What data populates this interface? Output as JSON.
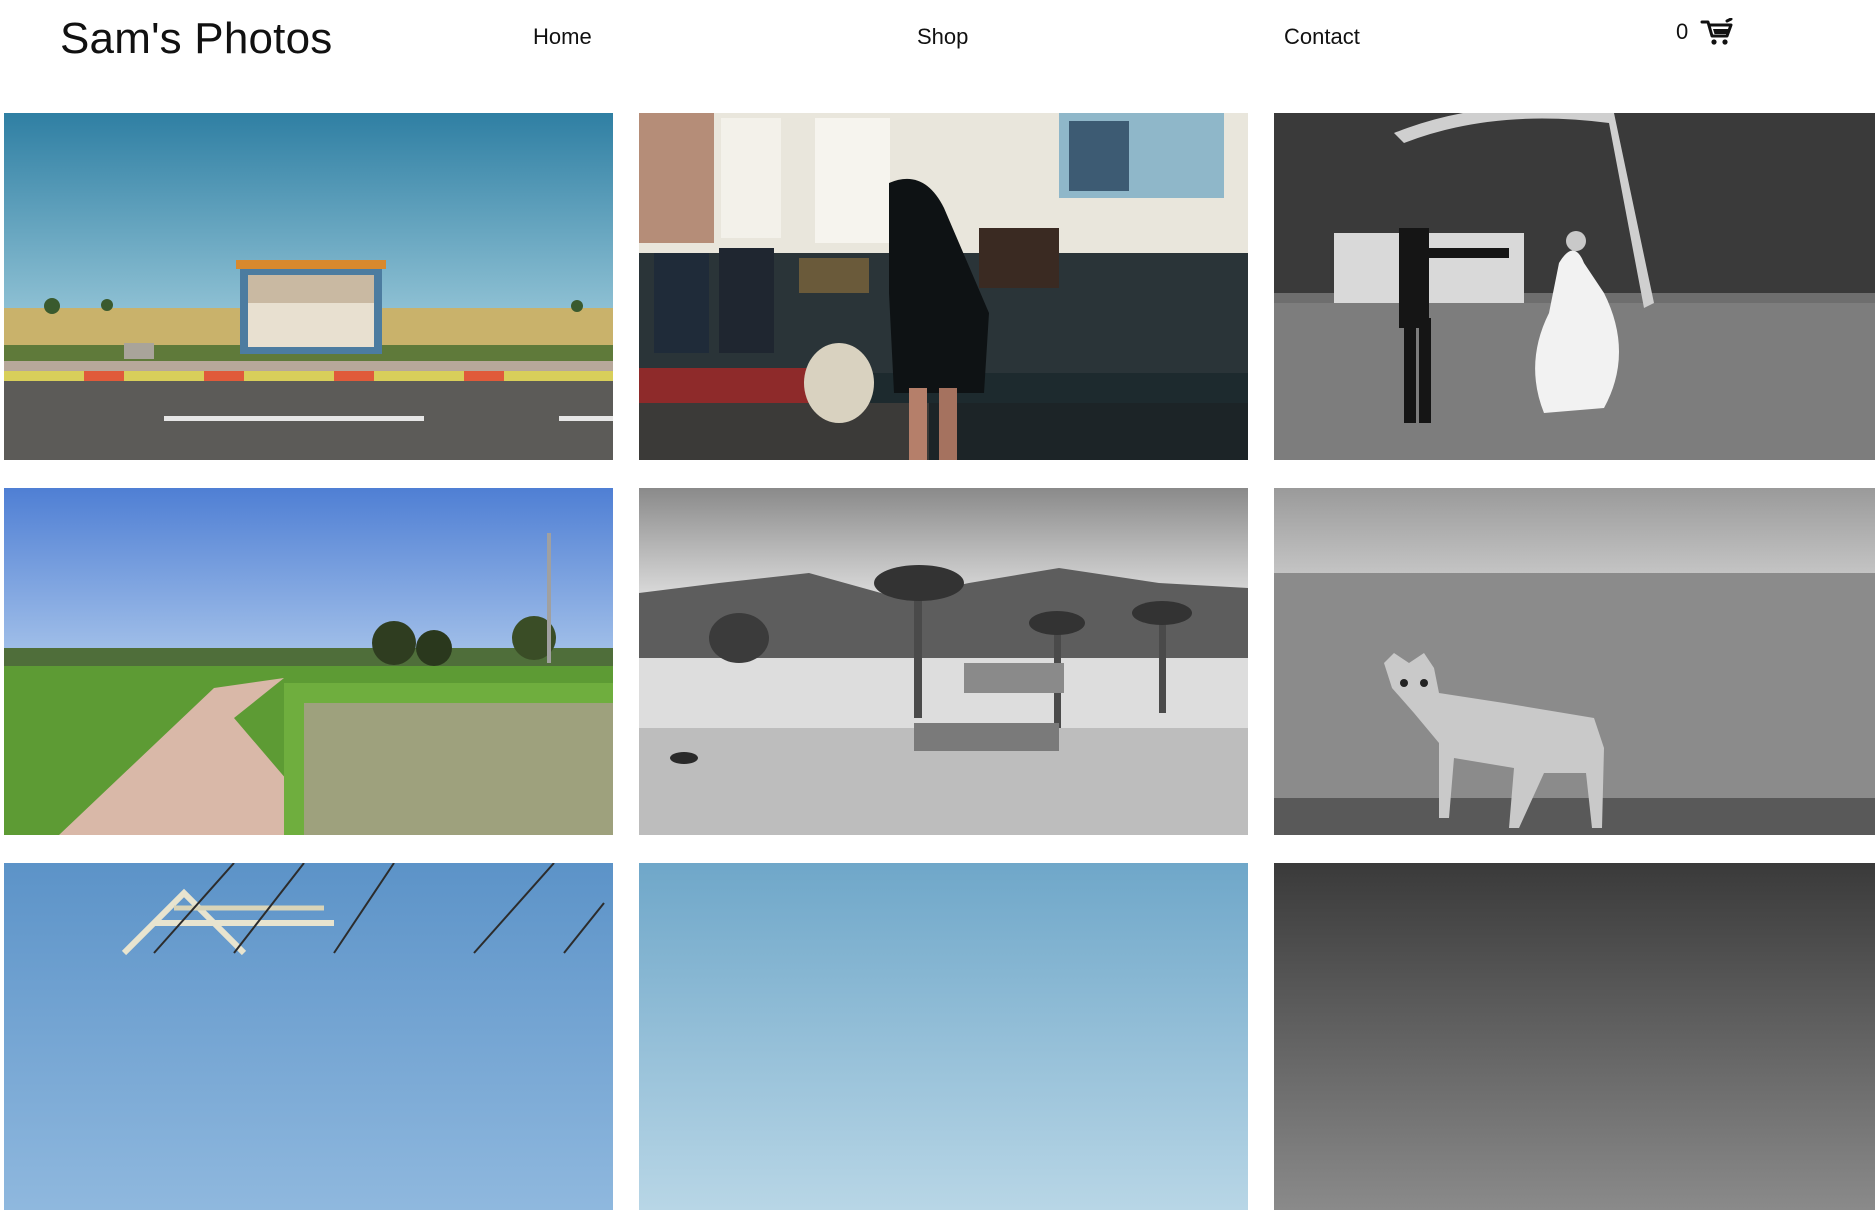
{
  "header": {
    "logo": "Sam's Photos",
    "nav": [
      {
        "label": "Home"
      },
      {
        "label": "Shop"
      },
      {
        "label": "Contact"
      }
    ],
    "cart": {
      "count": "0",
      "icon": "cart-icon"
    }
  },
  "gallery": {
    "photos": [
      {
        "name": "photo-bus-stop"
      },
      {
        "name": "photo-concert-room"
      },
      {
        "name": "photo-wedding-dance"
      },
      {
        "name": "photo-country-path"
      },
      {
        "name": "photo-desert-palms"
      },
      {
        "name": "photo-wet-dog"
      },
      {
        "name": "photo-power-lines"
      },
      {
        "name": "photo-blue-sky"
      },
      {
        "name": "photo-dark-gradient"
      }
    ]
  }
}
